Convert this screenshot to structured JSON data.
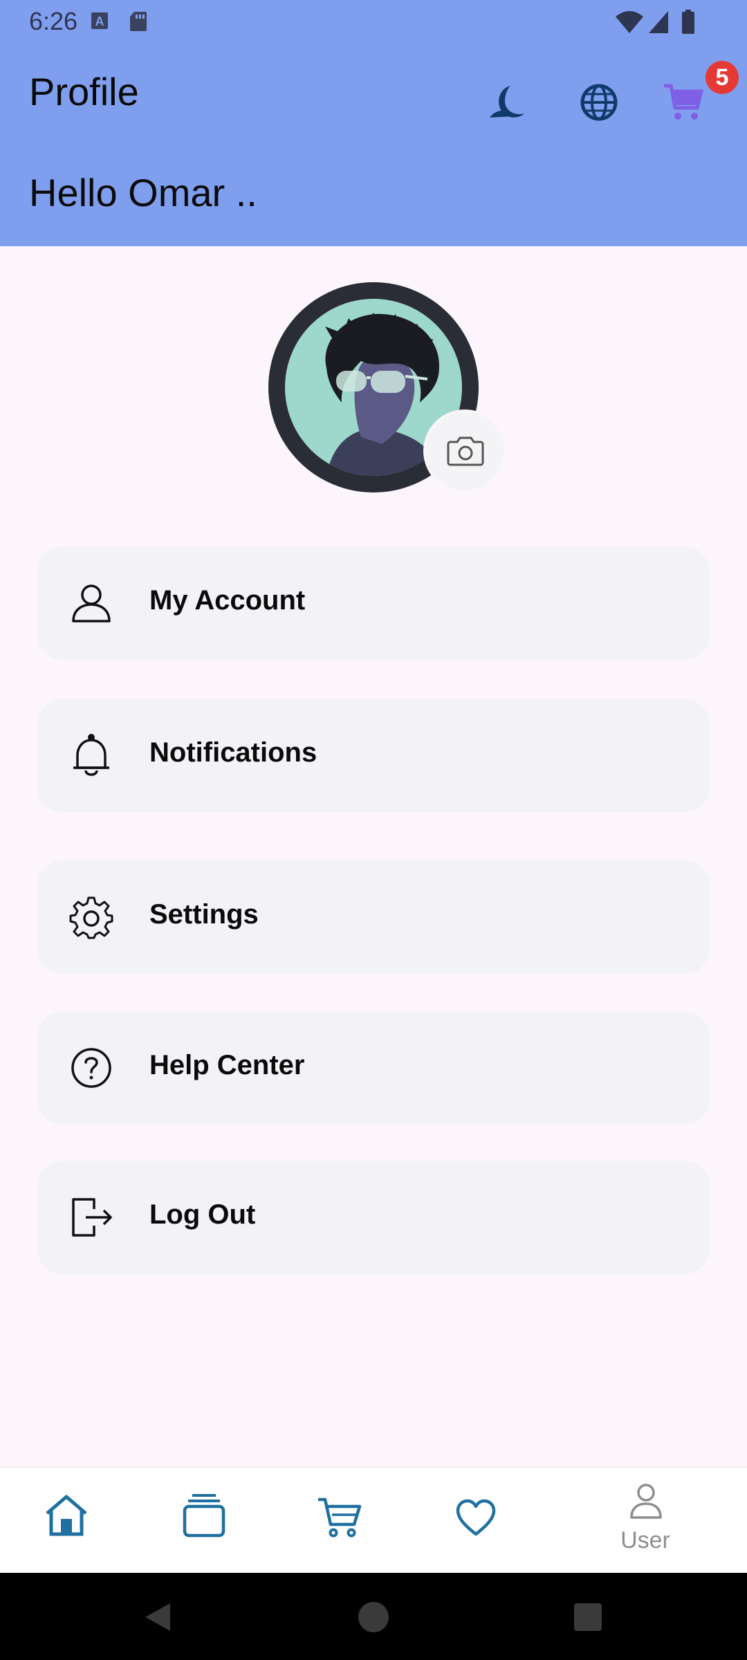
{
  "status_bar": {
    "time": "6:26"
  },
  "header": {
    "title": "Profile",
    "greeting": "Hello Omar ..",
    "cart_count": "5",
    "icons": [
      "moon-icon",
      "globe-icon",
      "cart-icon"
    ]
  },
  "profile": {
    "avatar_icon": "avatar",
    "camera_icon": "camera-icon"
  },
  "menu": {
    "items": [
      {
        "label": "My Account",
        "icon": "user-icon"
      },
      {
        "label": "Notifications",
        "icon": "bell-icon"
      },
      {
        "label": "Settings",
        "icon": "gear-icon"
      },
      {
        "label": "Help Center",
        "icon": "help-icon"
      },
      {
        "label": "Log Out",
        "icon": "logout-icon"
      }
    ]
  },
  "bottom_nav": {
    "items": [
      {
        "icon": "home-icon"
      },
      {
        "icon": "categories-icon"
      },
      {
        "icon": "cart-icon"
      },
      {
        "icon": "heart-icon"
      },
      {
        "icon": "user-icon",
        "label": "User"
      }
    ]
  },
  "colors": {
    "header_bg": "#7F9FEE",
    "page_bg": "#FCF6FC",
    "card_bg": "#F3F3F7",
    "nav_accent": "#1F6FA0",
    "cart_accent": "#7E5FE6",
    "badge": "#E53935"
  }
}
